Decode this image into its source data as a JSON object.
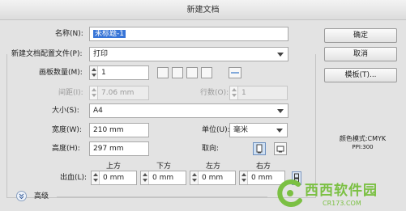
{
  "dialog": {
    "title": "新建文档"
  },
  "name": {
    "label": "名称(N):",
    "value": "未标题-1"
  },
  "profile": {
    "label": "新建文档配置文件(P):",
    "value": "打印"
  },
  "artboards": {
    "count_label": "画板数量(M):",
    "count_value": "1",
    "spacing_label": "间距(I):",
    "spacing_value": "7.06 mm",
    "columns_label": "行数(O):",
    "columns_value": "1"
  },
  "size": {
    "label": "大小(S):",
    "value": "A4"
  },
  "width": {
    "label": "宽度(W):",
    "value": "210 mm"
  },
  "units": {
    "label": "单位(U):",
    "value": "毫米"
  },
  "height": {
    "label": "高度(H):",
    "value": "297 mm"
  },
  "orientation": {
    "label": "取向:"
  },
  "bleed": {
    "label": "出血(L):",
    "top_label": "上方",
    "top_value": "0 mm",
    "bottom_label": "下方",
    "bottom_value": "0 mm",
    "left_label": "左方",
    "left_value": "0 mm",
    "right_label": "右方",
    "right_value": "0 mm"
  },
  "advanced": {
    "label": "高级"
  },
  "buttons": {
    "ok": "确定",
    "cancel": "取消",
    "templates": "模板(T)..."
  },
  "color_info": {
    "mode": "颜色模式:CMYK",
    "ppi": "PPI:300"
  },
  "watermark": {
    "text": "西西软件园",
    "url": "CR173.COM"
  }
}
